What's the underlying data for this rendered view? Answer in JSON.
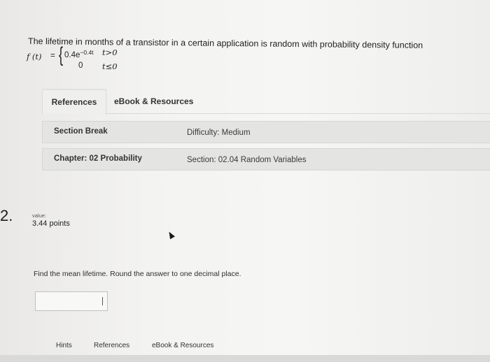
{
  "problem": {
    "statement": "The lifetime in months of a transistor in a certain application is random with probability density function",
    "formula": {
      "function_name": "f (t)",
      "equals": "=",
      "case1_coefficient": "0.4e",
      "case1_exponent": "−0.4t",
      "case1_condition": "t>0",
      "case2_value": "0",
      "case2_condition": "t≤0"
    }
  },
  "tabs": {
    "references": "References",
    "ebook": "eBook & Resources"
  },
  "meta": {
    "section_break": "Section Break",
    "difficulty": "Difficulty: Medium",
    "chapter": "Chapter: 02 Probability",
    "section": "Section: 02.04 Random Variables"
  },
  "question": {
    "number": "2.",
    "value_label": "value:",
    "points": "3.44 points",
    "instruction": "Find the mean lifetime. Round the answer to one decimal place.",
    "answer_value": ""
  },
  "bottom_tabs": {
    "hints": "Hints",
    "references": "References",
    "ebook": "eBook & Resources"
  }
}
